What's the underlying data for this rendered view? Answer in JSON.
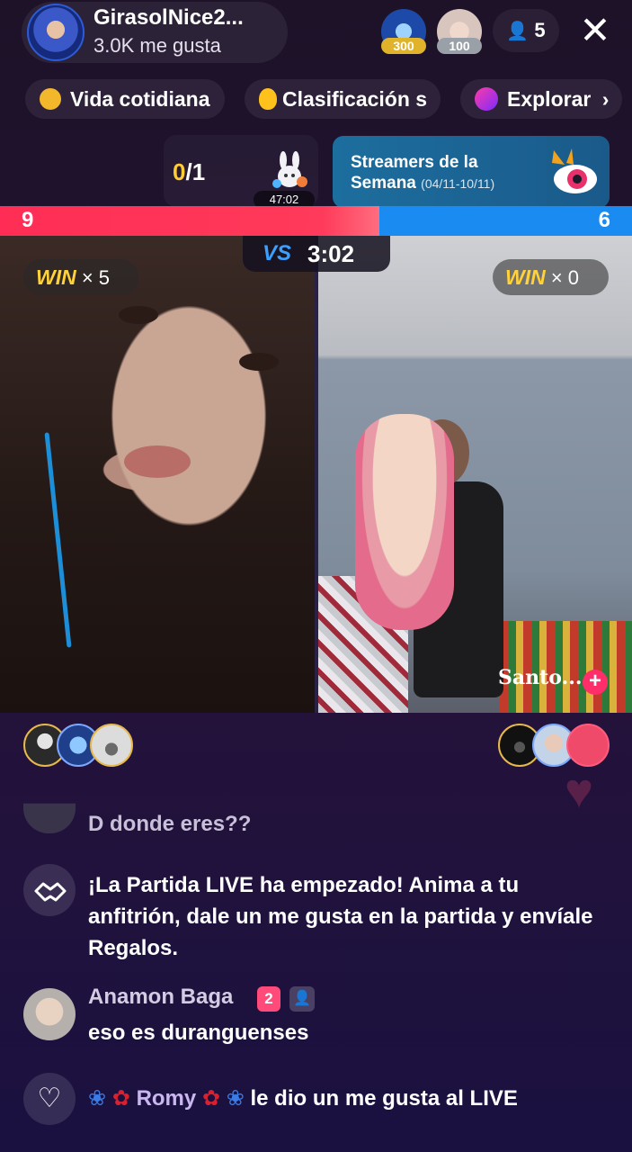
{
  "header": {
    "host_name": "GirasolNice2...",
    "host_likes": "3.0K me gusta",
    "top_viewers": [
      {
        "badge": "300"
      },
      {
        "badge": "100"
      }
    ],
    "viewer_count": "5",
    "close_icon": "close-icon"
  },
  "chips": [
    {
      "label": "Vida cotidiana",
      "icon": "hashtag-coin-icon"
    },
    {
      "label": "Clasificación s",
      "icon": "flame-icon"
    },
    {
      "label": "Explorar",
      "icon": "planet-icon"
    }
  ],
  "match": {
    "progress_current": "0",
    "progress_total": "/1",
    "timer_mini": "47:02"
  },
  "banner": {
    "title": "Streamers de la Semana",
    "date": "(04/11-10/11)"
  },
  "pk": {
    "left_score": "9",
    "right_score": "6",
    "left_share": 0.6,
    "timer": "3:02",
    "vs_v": "V",
    "vs_s": "S"
  },
  "win_left": {
    "label": "WIN",
    "count": "× 5"
  },
  "win_right": {
    "label": "WIN",
    "count": "× 0"
  },
  "opponent": {
    "name": "Santo..."
  },
  "chat": [
    {
      "type": "user",
      "text": "D donde eres??"
    },
    {
      "type": "system",
      "text": "¡La Partida LIVE ha empezado! Anima a tu anfitrión, dale un me gusta en la partida y envíale Regalos."
    },
    {
      "type": "user",
      "name": "Anamon Baga",
      "level": "2",
      "text": "eso es duranguenses"
    },
    {
      "type": "like",
      "name": "Romy",
      "text": "le dio un me gusta al LIVE"
    }
  ],
  "colors": {
    "pk_red": "#ff2d55",
    "pk_blue": "#1a8bf0",
    "win_yellow": "#ffd23a",
    "background": "#24123a"
  }
}
